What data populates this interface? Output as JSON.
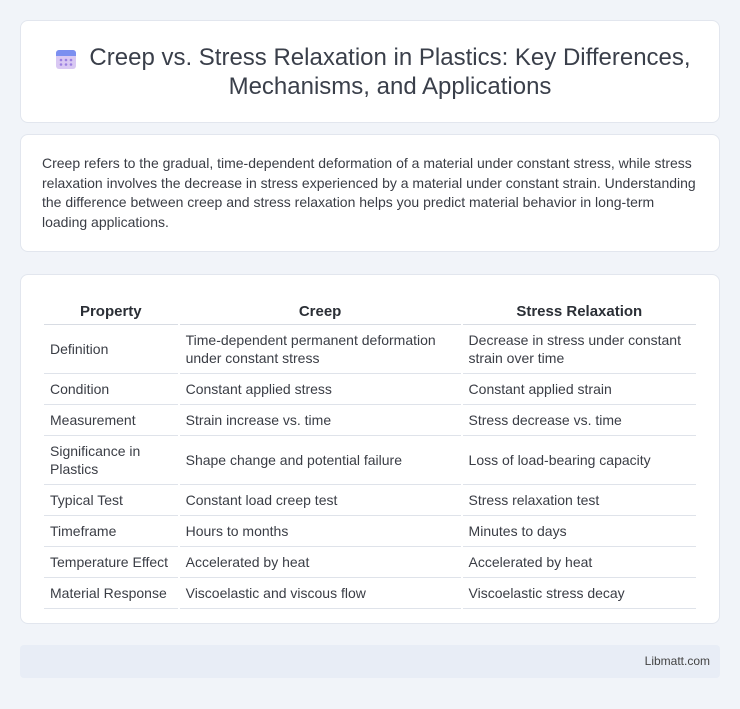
{
  "header": {
    "title": "Creep vs. Stress Relaxation in Plastics: Key Differences, Mechanisms, and Applications",
    "icon": "calendar-icon"
  },
  "intro": {
    "text": "Creep refers to the gradual, time-dependent deformation of a material under constant stress, while stress relaxation involves the decrease in stress experienced by a material under constant strain. Understanding the difference between creep and stress relaxation helps you predict material behavior in long-term loading applications."
  },
  "table": {
    "headers": [
      "Property",
      "Creep",
      "Stress Relaxation"
    ],
    "rows": [
      [
        "Definition",
        "Time-dependent permanent deformation under constant stress",
        "Decrease in stress under constant strain over time"
      ],
      [
        "Condition",
        "Constant applied stress",
        "Constant applied strain"
      ],
      [
        "Measurement",
        "Strain increase vs. time",
        "Stress decrease vs. time"
      ],
      [
        "Significance in Plastics",
        "Shape change and potential failure",
        "Loss of load-bearing capacity"
      ],
      [
        "Typical Test",
        "Constant load creep test",
        "Stress relaxation test"
      ],
      [
        "Timeframe",
        "Hours to months",
        "Minutes to days"
      ],
      [
        "Temperature Effect",
        "Accelerated by heat",
        "Accelerated by heat"
      ],
      [
        "Material Response",
        "Viscoelastic and viscous flow",
        "Viscoelastic stress decay"
      ]
    ]
  },
  "footer": {
    "text": "Libmatt.com"
  }
}
